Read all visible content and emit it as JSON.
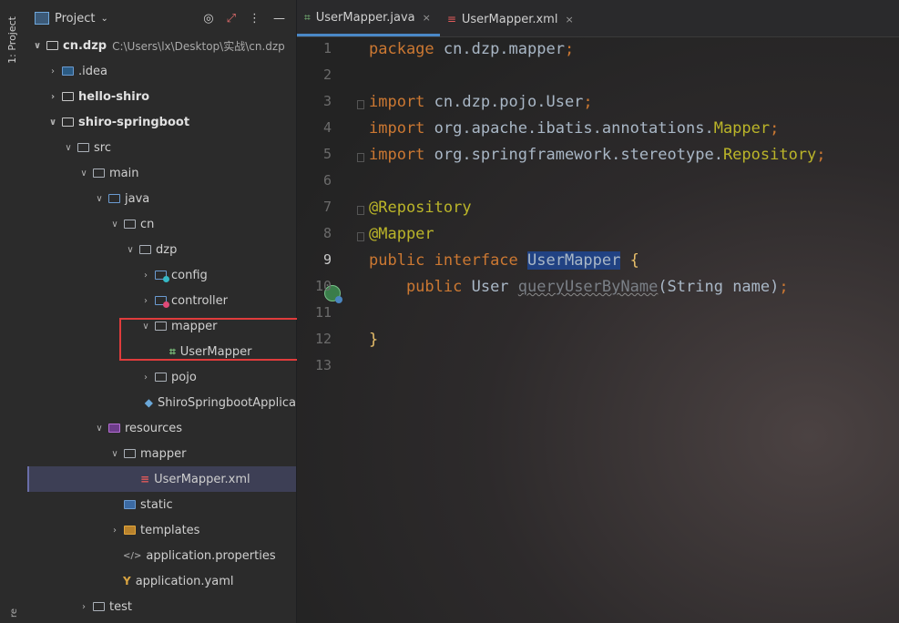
{
  "side_strip": {
    "label": "1: Project",
    "bottom_label": "re"
  },
  "project_panel": {
    "title": "Project",
    "tools": [
      "target-icon",
      "collapse-icon",
      "more-icon",
      "hide-icon"
    ],
    "tree": [
      {
        "label": "cn.dzp",
        "hint": "C:\\Users\\lx\\Desktop\\实战\\cn.dzp",
        "indent": 0,
        "arrow": "v",
        "icon": "module",
        "bold": true
      },
      {
        "label": ".idea",
        "indent": 1,
        "arrow": ">",
        "icon": "idea"
      },
      {
        "label": "hello-shiro",
        "indent": 1,
        "arrow": ">",
        "icon": "module",
        "bold": true
      },
      {
        "label": "shiro-springboot",
        "indent": 1,
        "arrow": "v",
        "icon": "module",
        "bold": true
      },
      {
        "label": "src",
        "indent": 2,
        "arrow": "v",
        "icon": "folder"
      },
      {
        "label": "main",
        "indent": 3,
        "arrow": "v",
        "icon": "folder"
      },
      {
        "label": "java",
        "indent": 4,
        "arrow": "v",
        "icon": "blue"
      },
      {
        "label": "cn",
        "indent": 5,
        "arrow": "v",
        "icon": "folder"
      },
      {
        "label": "dzp",
        "indent": 6,
        "arrow": "v",
        "icon": "folder"
      },
      {
        "label": "config",
        "indent": 7,
        "arrow": ">",
        "icon": "teal"
      },
      {
        "label": "controller",
        "indent": 7,
        "arrow": ">",
        "icon": "pink"
      },
      {
        "label": "mapper",
        "indent": 7,
        "arrow": "v",
        "icon": "folder"
      },
      {
        "label": "UserMapper",
        "indent": 8,
        "arrow": "",
        "icon": "interface"
      },
      {
        "label": "pojo",
        "indent": 7,
        "arrow": ">",
        "icon": "folder"
      },
      {
        "label": "ShiroSpringbootApplica",
        "indent": 7,
        "arrow": "",
        "icon": "springapp"
      },
      {
        "label": "resources",
        "indent": 4,
        "arrow": "v",
        "icon": "purple"
      },
      {
        "label": "mapper",
        "indent": 5,
        "arrow": "v",
        "icon": "folder"
      },
      {
        "label": "UserMapper.xml",
        "indent": 6,
        "arrow": "",
        "icon": "xml",
        "selected": true
      },
      {
        "label": "static",
        "indent": 5,
        "arrow": "",
        "icon": "static"
      },
      {
        "label": "templates",
        "indent": 5,
        "arrow": ">",
        "icon": "orange"
      },
      {
        "label": "application.properties",
        "indent": 5,
        "arrow": "",
        "icon": "props"
      },
      {
        "label": "application.yaml",
        "indent": 5,
        "arrow": "",
        "icon": "yaml"
      },
      {
        "label": "test",
        "indent": 3,
        "arrow": ">",
        "icon": "folder"
      }
    ]
  },
  "tabs": [
    {
      "label": "UserMapper.java",
      "active": true,
      "close": "×"
    },
    {
      "label": "UserMapper.xml",
      "active": false,
      "close": "×"
    }
  ],
  "editor": {
    "line_numbers": [
      "1",
      "2",
      "3",
      "4",
      "5",
      "6",
      "7",
      "8",
      "9",
      "10",
      "11",
      "12",
      "13"
    ],
    "current_line": "9",
    "lines": [
      [
        {
          "t": "package ",
          "c": "kw"
        },
        {
          "t": "cn.dzp.mapper",
          "c": "id"
        },
        {
          "t": ";",
          "c": "pun"
        }
      ],
      [],
      [
        {
          "t": "import ",
          "c": "kw"
        },
        {
          "t": "cn.dzp.pojo.User",
          "c": "id"
        },
        {
          "t": ";",
          "c": "pun"
        }
      ],
      [
        {
          "t": "import ",
          "c": "kw"
        },
        {
          "t": "org.apache.ibatis.annotations.",
          "c": "id"
        },
        {
          "t": "Mapper",
          "c": "ann-cls"
        },
        {
          "t": ";",
          "c": "pun"
        }
      ],
      [
        {
          "t": "import ",
          "c": "kw"
        },
        {
          "t": "org.springframework.stereotype.",
          "c": "id"
        },
        {
          "t": "Repository",
          "c": "ann-cls"
        },
        {
          "t": ";",
          "c": "pun"
        }
      ],
      [],
      [
        {
          "t": "@Repository",
          "c": "ann"
        }
      ],
      [
        {
          "t": "@Mapper",
          "c": "ann"
        }
      ],
      [
        {
          "t": "public ",
          "c": "kw"
        },
        {
          "t": "interface ",
          "c": "kw"
        },
        {
          "t": "UserMapper",
          "c": "sel"
        },
        {
          "t": " {",
          "c": "brace"
        }
      ],
      [
        {
          "t": "    public ",
          "c": "kw"
        },
        {
          "t": "User ",
          "c": "cls"
        },
        {
          "t": "queryUserByName",
          "c": "fn-dim"
        },
        {
          "t": "(String name)",
          "c": "id"
        },
        {
          "t": ";",
          "c": "pun"
        }
      ],
      [],
      [
        {
          "t": "}",
          "c": "brace"
        }
      ],
      []
    ]
  }
}
